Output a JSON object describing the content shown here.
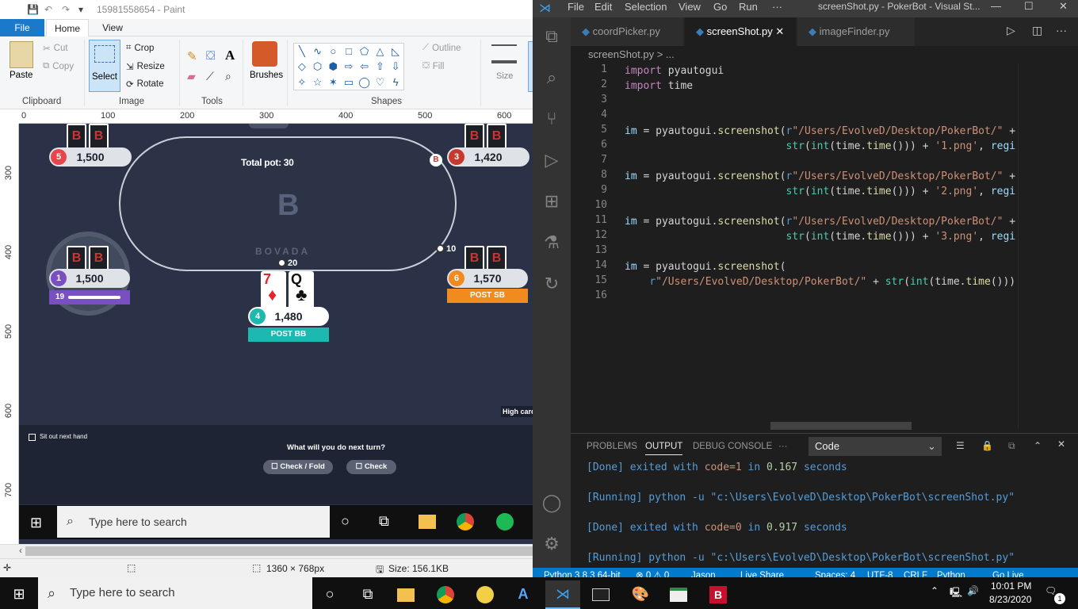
{
  "paint": {
    "title": "15981558654 - Paint",
    "menu": {
      "file": "File",
      "home": "Home",
      "view": "View"
    },
    "ribbon": {
      "paste": "Paste",
      "cut": "Cut",
      "copy": "Copy",
      "select": "Select",
      "crop": "Crop",
      "resize": "Resize",
      "rotate": "Rotate",
      "brushes": "Brushes",
      "outline": "Outline",
      "fill": "Fill",
      "size": "Size",
      "groups": {
        "clipboard": "Clipboard",
        "image": "Image",
        "tools": "Tools",
        "shapes": "Shapes"
      }
    },
    "ruler_h": [
      "0",
      "100",
      "200",
      "300",
      "400",
      "500",
      "600"
    ],
    "ruler_v": [
      "300",
      "400",
      "500",
      "600",
      "700"
    ],
    "status": {
      "dimensions": "1360 × 768px",
      "size": "Size: 156.1KB"
    }
  },
  "poker": {
    "total_pot": "Total pot: 30",
    "brand": "BOVADA",
    "brand_letter": "B",
    "seats": [
      {
        "num": "5",
        "stack": "1,500",
        "color": "#e6474c"
      },
      {
        "num": "3",
        "stack": "1,420",
        "color": "#c7392f"
      },
      {
        "num": "1",
        "stack": "1,500",
        "color": "#7a4fc0",
        "timer": "19"
      },
      {
        "num": "6",
        "stack": "1,570",
        "color": "#f28b1f",
        "tag": "POST SB"
      },
      {
        "num": "4",
        "stack": "1,480",
        "color": "#1db9b0",
        "tag": "POST BB"
      }
    ],
    "bet_sb": "10",
    "bet_bb": "20",
    "hero_cards": [
      {
        "rank": "7",
        "suit": "♦",
        "color": "#e3262e"
      },
      {
        "rank": "Q",
        "suit": "♣",
        "color": "#111"
      }
    ],
    "hand_info": "High card, Q",
    "sit_out": "Sit out next hand",
    "question": "What will you do next turn?",
    "buttons": {
      "check_fold": "Check / Fold",
      "check": "Check"
    },
    "inner_search": "Type here to search"
  },
  "vscode": {
    "menu": [
      "File",
      "Edit",
      "Selection",
      "View",
      "Go",
      "Run",
      "···"
    ],
    "title": "screenShot.py - PokerBot - Visual St...",
    "tabs": [
      "coordPicker.py",
      "screenShot.py",
      "imageFinder.py"
    ],
    "breadcrumb": "screenShot.py > ...",
    "line_numbers": [
      "1",
      "2",
      "3",
      "4",
      "5",
      "6",
      "7",
      "8",
      "9",
      "10",
      "11",
      "12",
      "13",
      "14",
      "15",
      "16"
    ],
    "panel_tabs": [
      "PROBLEMS",
      "OUTPUT",
      "DEBUG CONSOLE",
      "···"
    ],
    "output_select": "Code",
    "output": {
      "l1_a": "[Done] exited with ",
      "l1_b": "code=1",
      "l1_c": " in ",
      "l1_d": "0.167",
      "l1_e": " seconds",
      "l2": "[Running] python -u \"c:\\Users\\EvolveD\\Desktop\\PokerBot\\screenShot.py\"",
      "l3_a": "[Done] exited with ",
      "l3_b": "code=0",
      "l3_c": " in ",
      "l3_d": "0.917",
      "l3_e": " seconds",
      "l4": "[Running] python -u \"c:\\Users\\EvolveD\\Desktop\\PokerBot\\screenShot.py\""
    },
    "status": {
      "python": "Python 3.8.3 64-bit",
      "problems": "⊗ 0 ⚠ 0",
      "user": "Jason",
      "live_share": "Live Share",
      "spaces": "Spaces: 4",
      "encoding": "UTF-8",
      "eol": "CRLF",
      "lang": "Python",
      "go_live": "Go Live"
    }
  },
  "taskbar": {
    "search": "Type here to search",
    "time": "10:01 PM",
    "date": "8/23/2020",
    "notifications": "1"
  }
}
